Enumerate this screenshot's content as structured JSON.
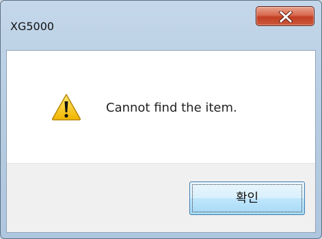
{
  "window": {
    "title": "XG5000"
  },
  "dialog": {
    "icon": "warning-icon",
    "message": "Cannot find the item."
  },
  "buttons": {
    "ok_label": "확인"
  },
  "colors": {
    "close_button": "#c94a2e",
    "ok_button_border": "#3d7bad",
    "warning_yellow": "#f7c600"
  }
}
